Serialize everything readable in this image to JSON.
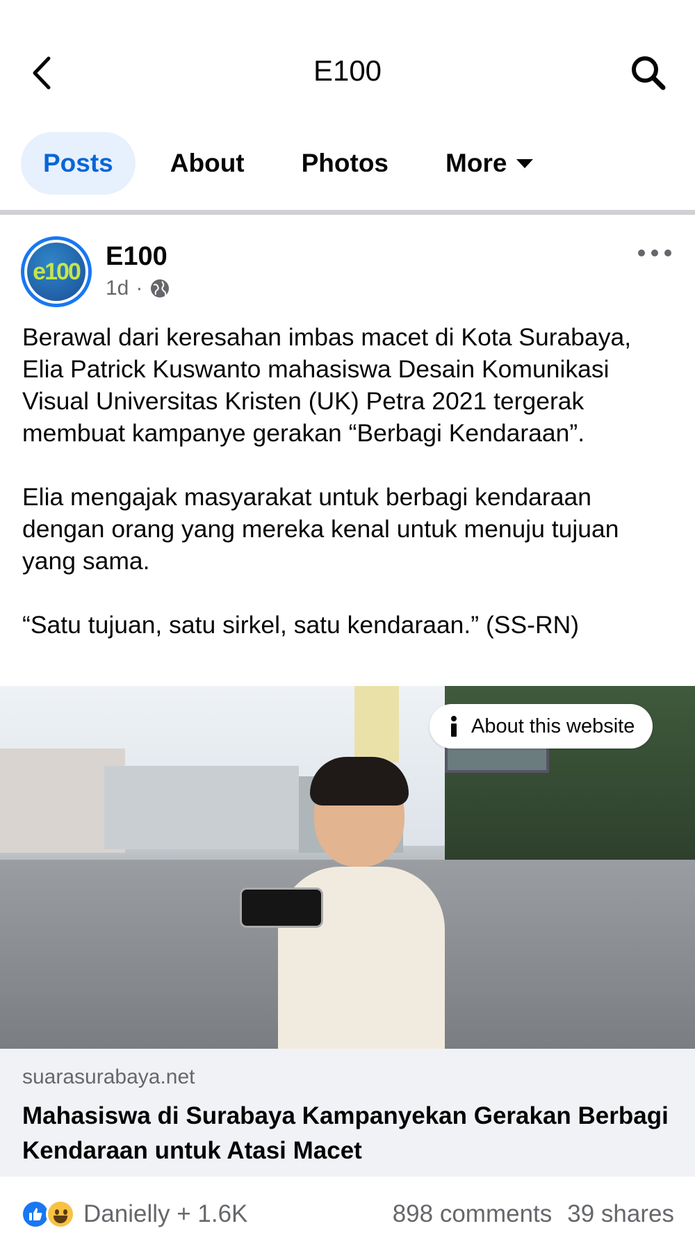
{
  "header": {
    "title": "E100",
    "back_icon": "chevron-left-icon",
    "search_icon": "search-icon"
  },
  "tabs": [
    {
      "label": "Posts",
      "active": true
    },
    {
      "label": "About",
      "active": false
    },
    {
      "label": "Photos",
      "active": false
    },
    {
      "label": "More",
      "active": false
    }
  ],
  "post": {
    "author": "E100",
    "avatar_text": "e100",
    "time": "1d",
    "separator": "·",
    "privacy_icon": "globe-icon",
    "paragraphs": [
      "Berawal dari keresahan imbas macet di Kota Surabaya, Elia Patrick Kuswanto mahasiswa Desain Komunikasi Visual Universitas Kristen (UK) Petra 2021 tergerak membuat kampanye gerakan “Berbagi Kendaraan”.",
      "Elia mengajak masyarakat untuk berbagi kendaraan dengan orang yang mereka kenal untuk menuju tujuan yang sama.",
      "“Satu tujuan, satu sirkel, satu kendaraan.” (SS-RN)"
    ],
    "link": {
      "about_label": "About this website",
      "domain": "suarasurabaya.net",
      "title": "Mahasiswa di Surabaya Kampanyekan Gerakan Berbagi Kendaraan untuk Atasi Macet"
    },
    "footer": {
      "reactions_label": "Danielly + 1.6K",
      "comments": "898 comments",
      "shares": "39 shares"
    }
  },
  "colors": {
    "accent": "#0866d6",
    "active_tab_bg": "#e7f0fd",
    "secondary_text": "#65676b",
    "divider": "#ced0d4",
    "caption_bg": "#f0f2f5"
  }
}
